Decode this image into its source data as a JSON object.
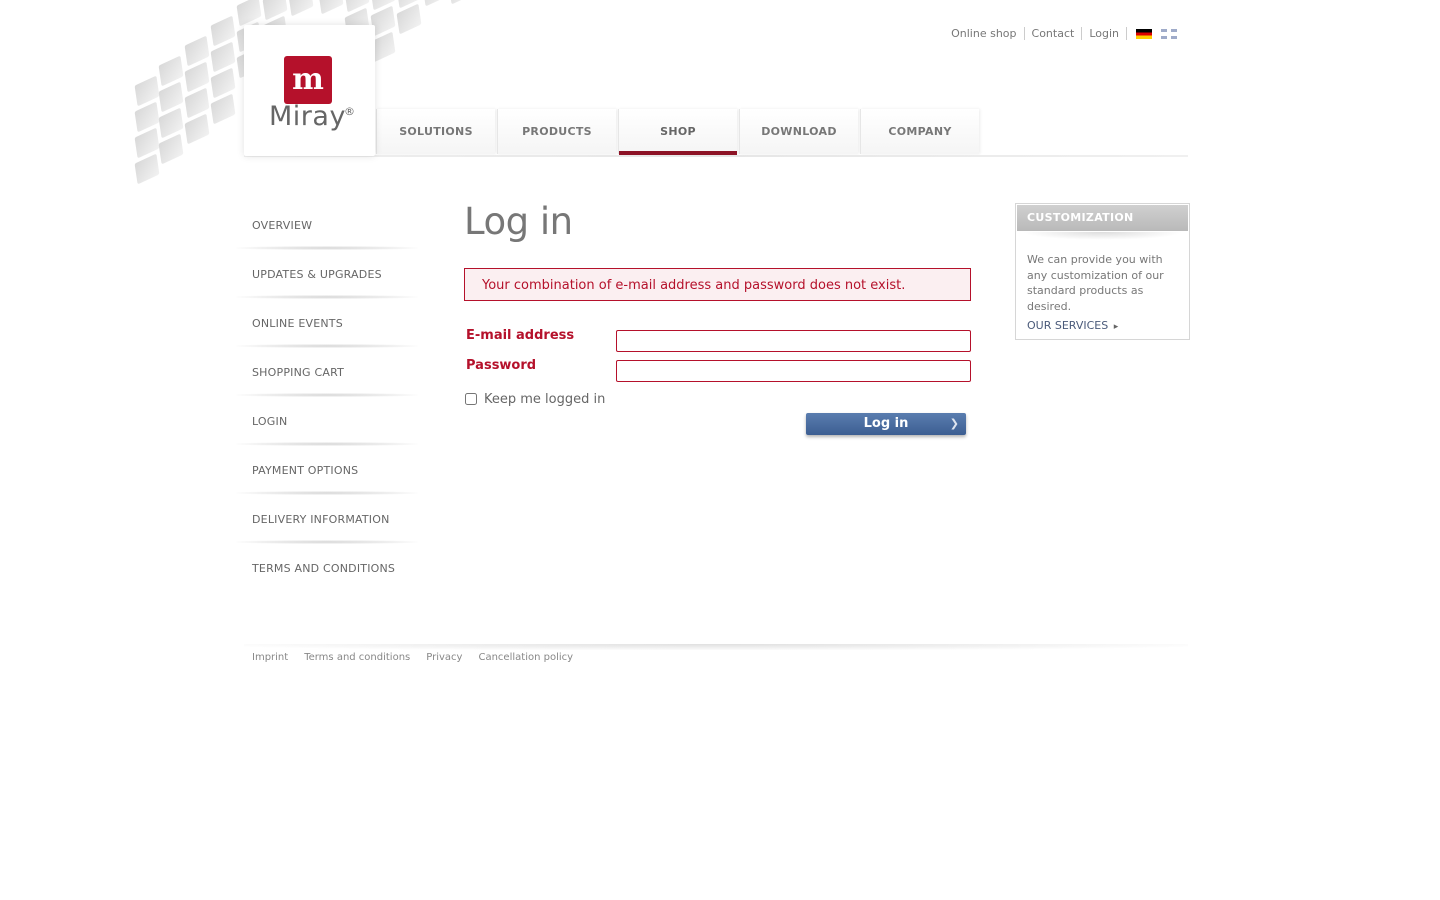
{
  "brand": {
    "mark": "m",
    "name": "Miray",
    "registered": "®",
    "color": "#b5112b"
  },
  "utility_nav": {
    "items": [
      "Online shop",
      "Contact",
      "Login"
    ],
    "flags": [
      "german-flag-icon",
      "english-flag-icon"
    ]
  },
  "main_nav": {
    "tabs": [
      "SOLUTIONS",
      "PRODUCTS",
      "SHOP",
      "DOWNLOAD",
      "COMPANY"
    ],
    "active": "SHOP",
    "active_color": "#8d1326"
  },
  "sidebar": {
    "items": [
      "OVERVIEW",
      "UPDATES & UPGRADES",
      "ONLINE EVENTS",
      "SHOPPING CART",
      "LOGIN",
      "PAYMENT OPTIONS",
      "DELIVERY INFORMATION",
      "TERMS AND CONDITIONS"
    ]
  },
  "login": {
    "title": "Log in",
    "error": "Your combination of e-mail address and password does not exist.",
    "email_label": "E-mail address",
    "email_value": "",
    "password_label": "Password",
    "password_value": "",
    "keep_label": "Keep me logged in",
    "keep_checked": false,
    "submit_label": "Log in",
    "button_color": "#4a6ca0"
  },
  "customization": {
    "title": "CUSTOMIZATION",
    "text": "We can provide you with any customization of our standard products as desired.",
    "link": "OUR SERVICES"
  },
  "footer": {
    "links": [
      "Imprint",
      "Terms and conditions",
      "Privacy",
      "Cancellation policy"
    ]
  }
}
